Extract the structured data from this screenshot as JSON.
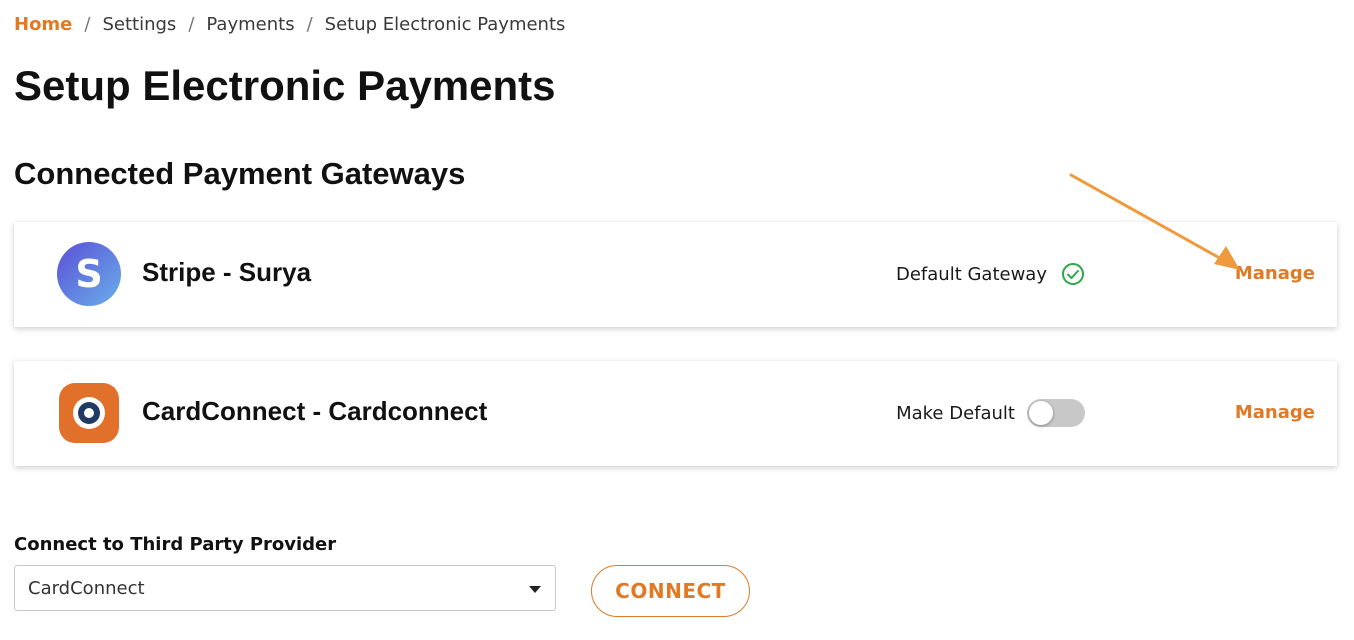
{
  "breadcrumb": {
    "items": [
      "Home",
      "Settings",
      "Payments",
      "Setup Electronic Payments"
    ],
    "separator": "/"
  },
  "page_title": "Setup Electronic Payments",
  "section_title": "Connected Payment Gateways",
  "gateways": [
    {
      "name": "Stripe - Surya",
      "status_label": "Default Gateway",
      "is_default": true,
      "manage_label": "Manage",
      "logo": "stripe-s-logo"
    },
    {
      "name": "CardConnect - Cardconnect",
      "status_label": "Make Default",
      "is_default": false,
      "manage_label": "Manage",
      "logo": "cardconnect-logo"
    }
  ],
  "provider": {
    "label": "Connect to Third Party Provider",
    "selected": "CardConnect",
    "connect_label": "CONNECT"
  },
  "colors": {
    "accent": "#e07a26",
    "success": "#2aa84a",
    "stripe_gradient_from": "#6a63d8",
    "stripe_gradient_to": "#6aa7e8",
    "cardconnect_orange": "#e0702a",
    "cardconnect_navy": "#1f3a63"
  }
}
